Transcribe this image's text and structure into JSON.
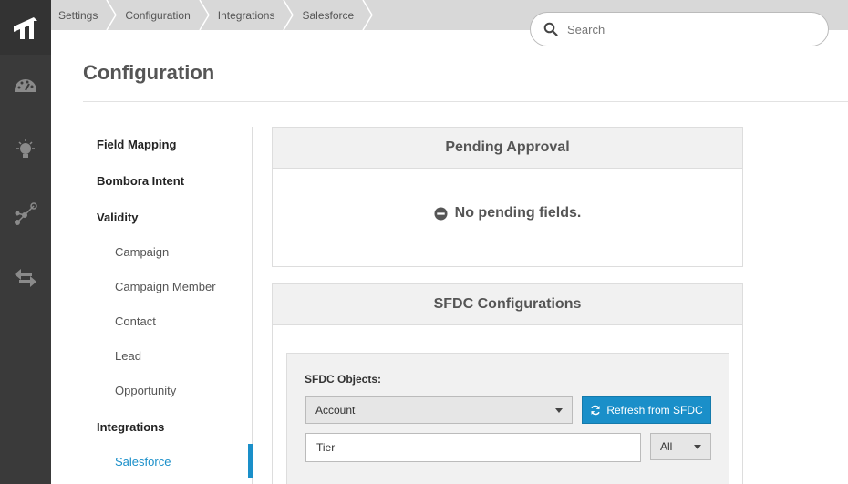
{
  "breadcrumb": [
    "Settings",
    "Configuration",
    "Integrations",
    "Salesforce"
  ],
  "search": {
    "placeholder": "Search",
    "value": ""
  },
  "page": {
    "title": "Configuration"
  },
  "sidenav": {
    "items": [
      {
        "label": "Field Mapping",
        "level": 1
      },
      {
        "label": "Bombora Intent",
        "level": 1
      },
      {
        "label": "Validity",
        "level": 1
      },
      {
        "label": "Campaign",
        "level": 2
      },
      {
        "label": "Campaign Member",
        "level": 2
      },
      {
        "label": "Contact",
        "level": 2
      },
      {
        "label": "Lead",
        "level": 2
      },
      {
        "label": "Opportunity",
        "level": 2
      },
      {
        "label": "Integrations",
        "level": 1
      },
      {
        "label": "Salesforce",
        "level": 2,
        "active": true
      }
    ]
  },
  "pending": {
    "title": "Pending Approval",
    "message": "No pending fields."
  },
  "sfdc": {
    "title": "SFDC Configurations",
    "objects_label": "SFDC Objects:",
    "object_selected": "Account",
    "refresh_label": "Refresh from SFDC",
    "filter_value": "Tier",
    "filter_type_selected": "All"
  },
  "colors": {
    "rail": "#3a3a3a",
    "accent": "#1a8fc9",
    "topbar": "#d8d8d8"
  }
}
